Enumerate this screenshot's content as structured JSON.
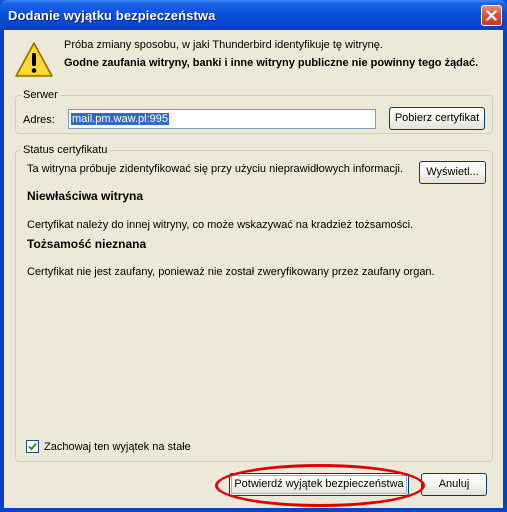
{
  "window": {
    "title": "Dodanie wyjątku bezpieczeństwa"
  },
  "message": {
    "line1": "Próba zmiany sposobu, w jaki Thunderbird identyfikuje tę witrynę.",
    "line2": "Godne zaufania witryny, banki i inne witryny publiczne nie powinny tego żądać."
  },
  "server": {
    "legend": "Serwer",
    "address_label": "Adres:",
    "address_value": "mail.pm.waw.pl:995",
    "fetch_button": "Pobierz certyfikat"
  },
  "status": {
    "legend": "Status certyfikatu",
    "intro": "Ta witryna próbuje zidentyfikować się przy użyciu nieprawidłowych informacji.",
    "view_button": "Wyświetl...",
    "wrong_site_heading": "Niewłaściwa witryna",
    "wrong_site_text": "Certyfikat należy do innej witryny, co może wskazywać na kradzież tożsamości.",
    "unknown_identity_heading": "Tożsamość nieznana",
    "unknown_identity_text": "Certyfikat nie jest zaufany, ponieważ nie został zweryfikowany przez zaufany organ."
  },
  "permanent_checkbox": {
    "label": "Zachowaj ten wyjątek na stałe",
    "checked": true
  },
  "buttons": {
    "confirm": "Potwierdź wyjątek bezpieczeństwa",
    "cancel": "Anuluj"
  },
  "colors": {
    "highlight": "#e00000",
    "titlebar": "#0a52dc",
    "selection": "#316ac5"
  },
  "icons": {
    "warning": "warning-icon",
    "close": "close-icon",
    "check": "check-icon"
  }
}
